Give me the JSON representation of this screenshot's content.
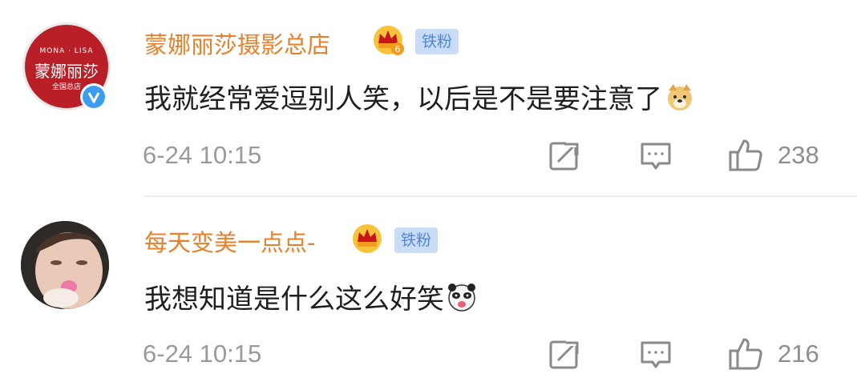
{
  "comments": [
    {
      "avatar": {
        "line1": "MONA · LISA",
        "line2": "蒙娜丽莎",
        "line3": "全国总店"
      },
      "username": "蒙娜丽莎摄影总店",
      "crown_level": "6",
      "badge": "铁粉",
      "text": "我就经常爱逗别人笑，以后是不是要注意了",
      "emoji": "doge-emoji",
      "timestamp": "6-24 10:15",
      "likes": "238"
    },
    {
      "username": "每天变美一点点-",
      "crown_level": "",
      "badge": "铁粉",
      "text": "我想知道是什么这么好笑",
      "emoji": "panda-emoji",
      "timestamp": "6-24 10:15",
      "likes": "216"
    }
  ],
  "colors": {
    "username": "#e8802b",
    "badge_bg": "#c9dcf5",
    "badge_text": "#4f86d6",
    "meta": "#9a9a9a",
    "verified": "#3b9cf0"
  },
  "icons": [
    "verified-icon",
    "crown-icon",
    "share-icon",
    "comment-icon",
    "like-icon"
  ]
}
